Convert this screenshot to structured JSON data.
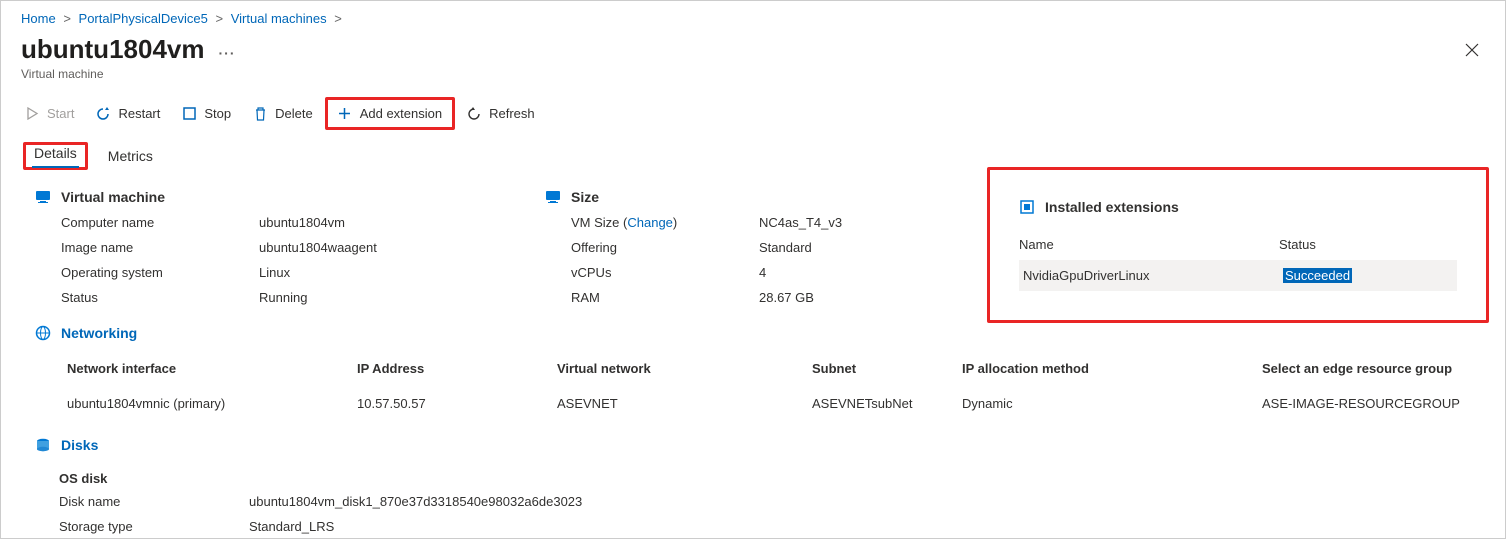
{
  "breadcrumb": {
    "home": "Home",
    "device": "PortalPhysicalDevice5",
    "vms": "Virtual machines"
  },
  "title": "ubuntu1804vm",
  "subtitle": "Virtual machine",
  "toolbar": {
    "start": "Start",
    "restart": "Restart",
    "stop": "Stop",
    "delete": "Delete",
    "add_ext": "Add extension",
    "refresh": "Refresh"
  },
  "tabs": {
    "details": "Details",
    "metrics": "Metrics"
  },
  "vm_section": {
    "title": "Virtual machine",
    "labels": {
      "cn": "Computer name",
      "img": "Image name",
      "os": "Operating system",
      "status": "Status"
    },
    "values": {
      "cn": "ubuntu1804vm",
      "img": "ubuntu1804waagent",
      "os": "Linux",
      "status": "Running"
    }
  },
  "size_section": {
    "title": "Size",
    "labels": {
      "size": "VM Size",
      "change": "Change",
      "offering": "Offering",
      "vcpus": "vCPUs",
      "ram": "RAM"
    },
    "values": {
      "size": "NC4as_T4_v3",
      "offering": "Standard",
      "vcpus": "4",
      "ram": "28.67 GB"
    }
  },
  "ext_section": {
    "title": "Installed extensions",
    "headers": {
      "name": "Name",
      "status": "Status"
    },
    "row": {
      "name": "NvidiaGpuDriverLinux",
      "status": "Succeeded"
    }
  },
  "net_section": {
    "title": "Networking",
    "headers": {
      "nic": "Network interface",
      "ip": "IP Address",
      "vnet": "Virtual network",
      "subnet": "Subnet",
      "alloc": "IP allocation method",
      "rg": "Select an edge resource group"
    },
    "row": {
      "nic": "ubuntu1804vmnic (primary)",
      "ip": "10.57.50.57",
      "vnet": "ASEVNET",
      "subnet": "ASEVNETsubNet",
      "alloc": "Dynamic",
      "rg": "ASE-IMAGE-RESOURCEGROUP"
    }
  },
  "disks_section": {
    "title": "Disks",
    "osdisk": "OS disk",
    "labels": {
      "name": "Disk name",
      "type": "Storage type"
    },
    "values": {
      "name": "ubuntu1804vm_disk1_870e37d3318540e98032a6de3023",
      "type": "Standard_LRS"
    }
  }
}
